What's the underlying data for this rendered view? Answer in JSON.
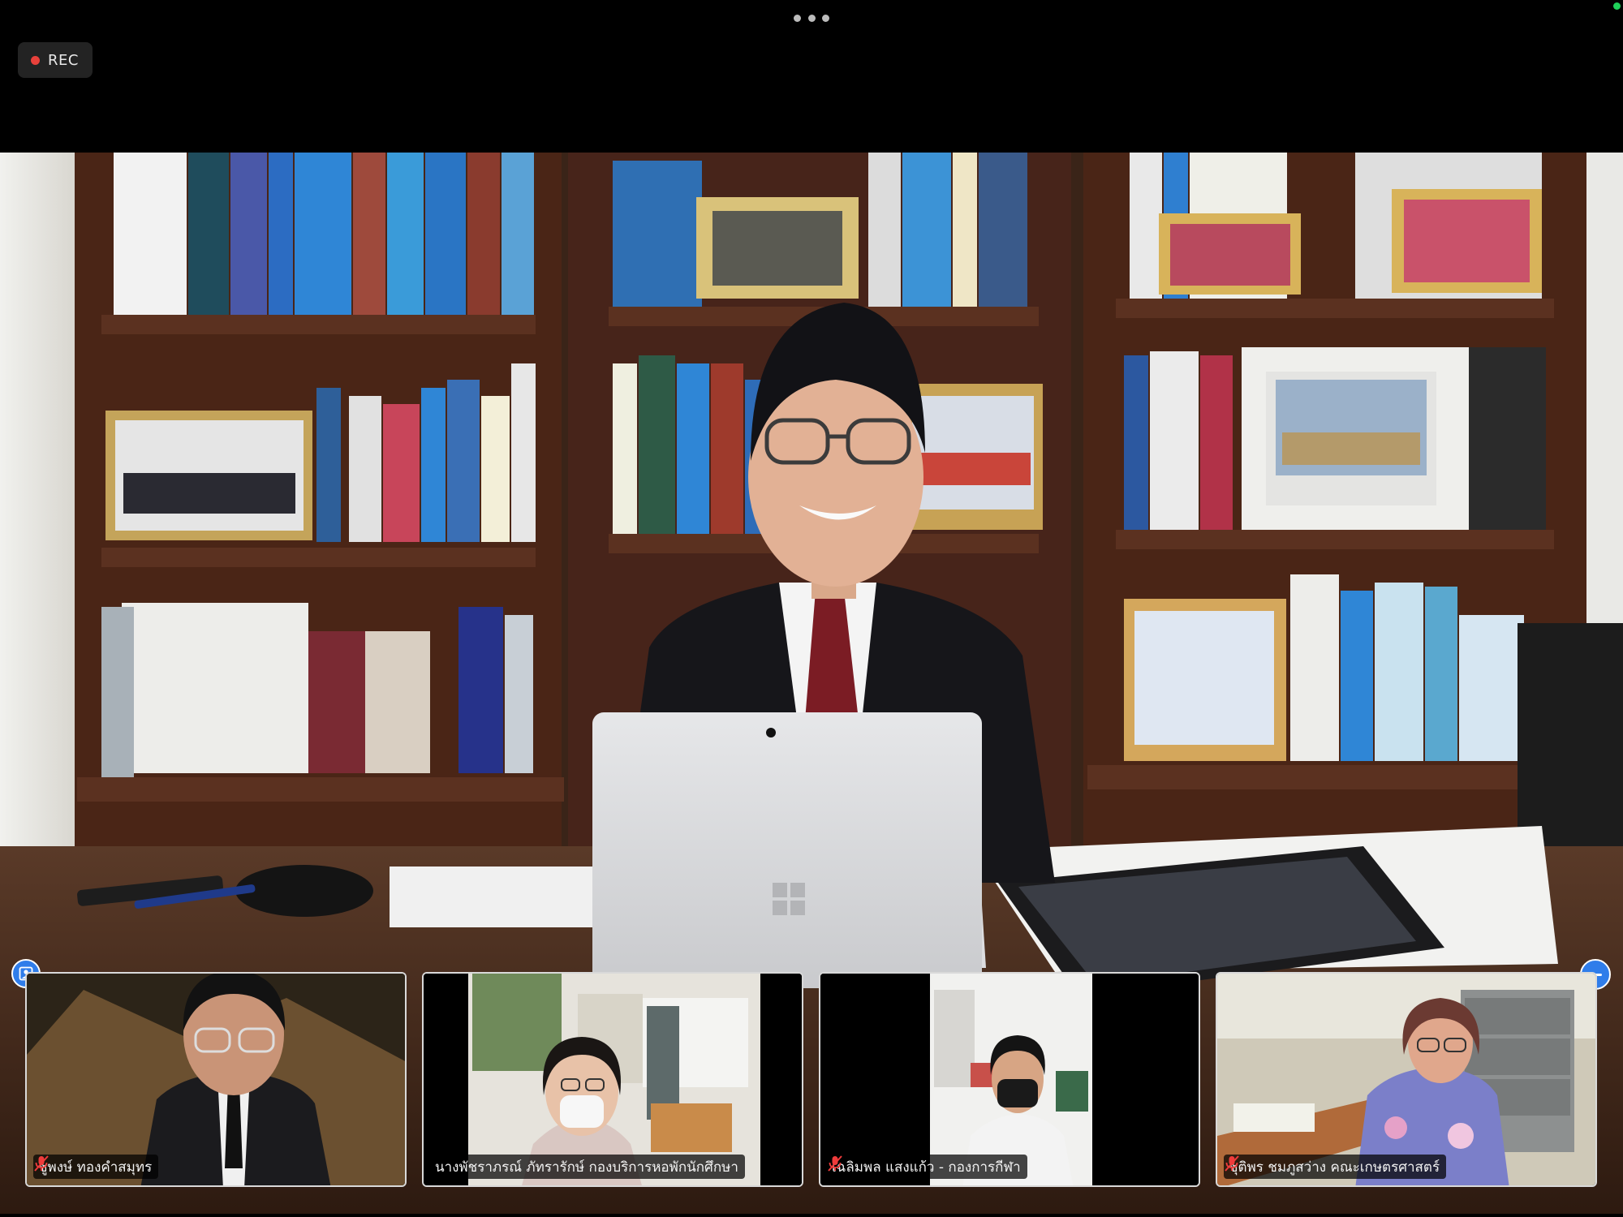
{
  "meeting": {
    "recording_label": "REC",
    "recording_color": "#e8413b",
    "accent_color": "#2f7dea",
    "more_options_icon": "more-dots-icon"
  },
  "main_speaker": {
    "scene": "speaker in office with bookshelves and laptop"
  },
  "participants": [
    {
      "name": "ชูพงษ์ ทองคำสมุทร",
      "muted": true
    },
    {
      "name": "นางพัชราภรณ์ ภัทรารักษ์ กองบริการหอพักนักศึกษา",
      "muted": false
    },
    {
      "name": "เฉลิมพล  แสงแก้ว - กองการกีฬา",
      "muted": true
    },
    {
      "name": "ชุติพร  ชมภูสว่าง คณะเกษตรศาสตร์",
      "muted": true
    }
  ]
}
